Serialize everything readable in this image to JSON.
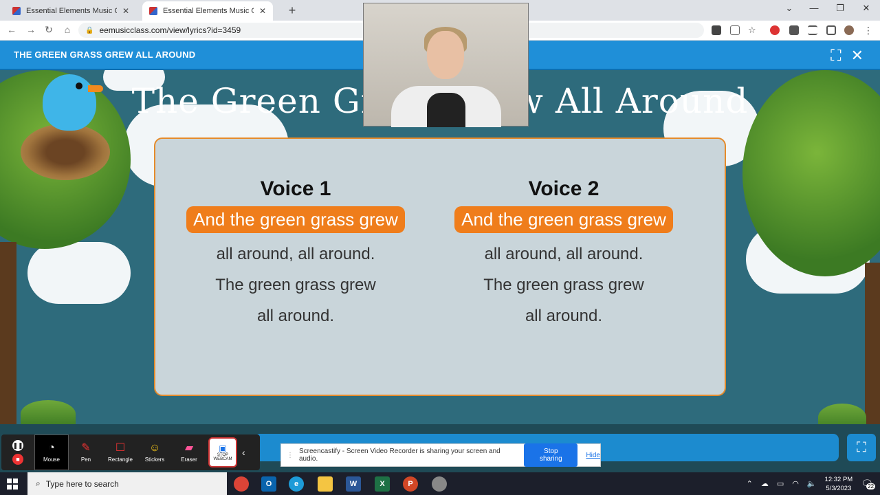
{
  "browser": {
    "tabs": [
      {
        "title": "Essential Elements Music Class",
        "active": false
      },
      {
        "title": "Essential Elements Music Cla",
        "active": true
      }
    ],
    "url": "eemusicclass.com/view/lyrics?id=3459"
  },
  "app": {
    "header_title": "THE GREEN GRASS GREW ALL AROUND",
    "slide_title": "The Green Grass Grew All Around",
    "voices": [
      {
        "heading": "Voice 1",
        "highlight": "And the green grass grew",
        "lines": [
          "all around, all around.",
          "The green grass grew",
          "all around."
        ]
      },
      {
        "heading": "Voice 2",
        "highlight": "And the green grass grew",
        "lines": [
          "all around, all around.",
          "The green grass grew",
          "all around."
        ]
      }
    ]
  },
  "annotation_toolbar": {
    "tools": [
      {
        "label": "Mouse",
        "icon": "mouse-pointer-icon",
        "selected": true
      },
      {
        "label": "Pen",
        "icon": "pen-icon",
        "selected": false
      },
      {
        "label": "Rectangle",
        "icon": "rectangle-icon",
        "selected": false
      },
      {
        "label": "Stickers",
        "icon": "sticker-icon",
        "selected": false
      },
      {
        "label": "Eraser",
        "icon": "eraser-icon",
        "selected": false
      }
    ],
    "webcam_label": "STOP WEBCAM"
  },
  "share_bar": {
    "message": "Screencastify - Screen Video Recorder is sharing your screen and audio.",
    "stop_label": "Stop sharing",
    "hide_label": "Hide"
  },
  "taskbar": {
    "search_placeholder": "Type here to search",
    "time": "12:32 PM",
    "date": "5/3/2023",
    "notifications": "22"
  },
  "colors": {
    "header_blue": "#1f8fd8",
    "highlight_orange": "#ef7d1b",
    "stage_teal": "#2e6b7c"
  }
}
